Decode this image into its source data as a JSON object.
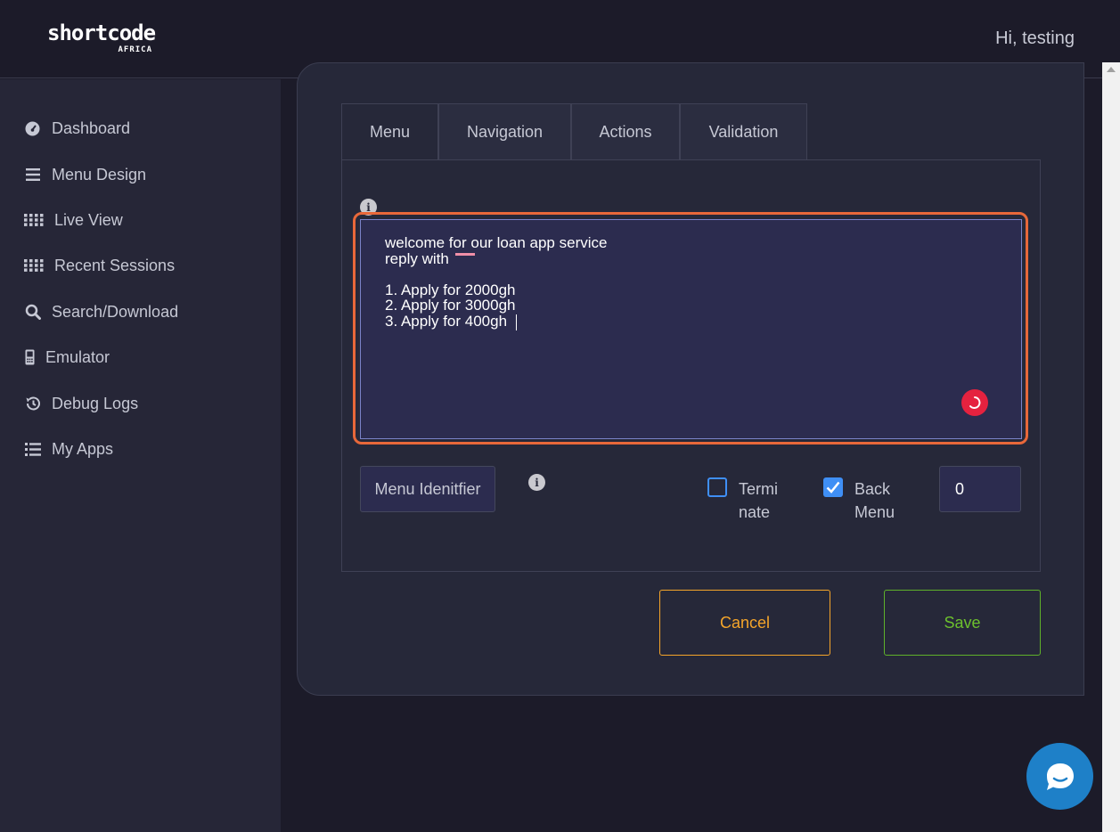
{
  "brand": {
    "name": "shortcode",
    "sub": "AFRICA"
  },
  "header": {
    "greeting": "Hi, testing"
  },
  "sidebar": {
    "items": [
      {
        "label": "Dashboard",
        "icon": "dashboard-gauge-icon"
      },
      {
        "label": "Menu Design",
        "icon": "bars-icon"
      },
      {
        "label": "Live View",
        "icon": "grid-dots-icon"
      },
      {
        "label": "Recent Sessions",
        "icon": "grid-dots-icon"
      },
      {
        "label": "Search/Download",
        "icon": "search-icon"
      },
      {
        "label": "Emulator",
        "icon": "phone-icon"
      },
      {
        "label": "Debug Logs",
        "icon": "history-icon"
      },
      {
        "label": "My Apps",
        "icon": "list-icon"
      }
    ]
  },
  "tabs": [
    {
      "label": "Menu",
      "active": true
    },
    {
      "label": "Navigation",
      "active": false
    },
    {
      "label": "Actions",
      "active": false
    },
    {
      "label": "Validation",
      "active": false
    }
  ],
  "menu_form": {
    "menu_text": "welcome for our loan app service\nreply with\n\n1. Apply for 2000gh\n2. Apply for 3000gh\n3. Apply for 400gh",
    "identifier_placeholder": "Menu Idenitfier",
    "terminate_label_line1": "Termi",
    "terminate_label_line2": "nate",
    "terminate_checked": false,
    "back_menu_label_line1": "Back",
    "back_menu_label_line2": "Menu",
    "back_menu_checked": true,
    "number_value": "0"
  },
  "buttons": {
    "cancel": "Cancel",
    "save": "Save"
  },
  "colors": {
    "focus_ring": "#e8683a",
    "cancel": "#f5a52a",
    "save": "#6cc02e",
    "checkbox": "#3f8ff5",
    "chat": "#1e80c8"
  }
}
